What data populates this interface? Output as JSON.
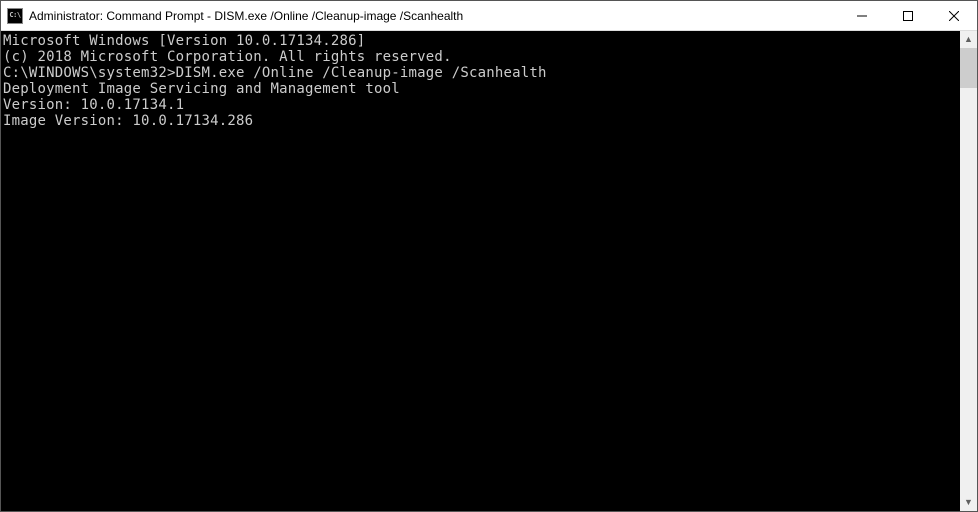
{
  "titlebar": {
    "icon_label": "C:\\",
    "title": "Administrator: Command Prompt - DISM.exe  /Online /Cleanup-image /Scanhealth"
  },
  "terminal": {
    "line1": "Microsoft Windows [Version 10.0.17134.286]",
    "line2": "(c) 2018 Microsoft Corporation. All rights reserved.",
    "line3": "",
    "line4": "C:\\WINDOWS\\system32>DISM.exe /Online /Cleanup-image /Scanhealth",
    "line5": "",
    "line6": "Deployment Image Servicing and Management tool",
    "line7": "Version: 10.0.17134.1",
    "line8": "",
    "line9": "Image Version: 10.0.17134.286",
    "line10": ""
  }
}
